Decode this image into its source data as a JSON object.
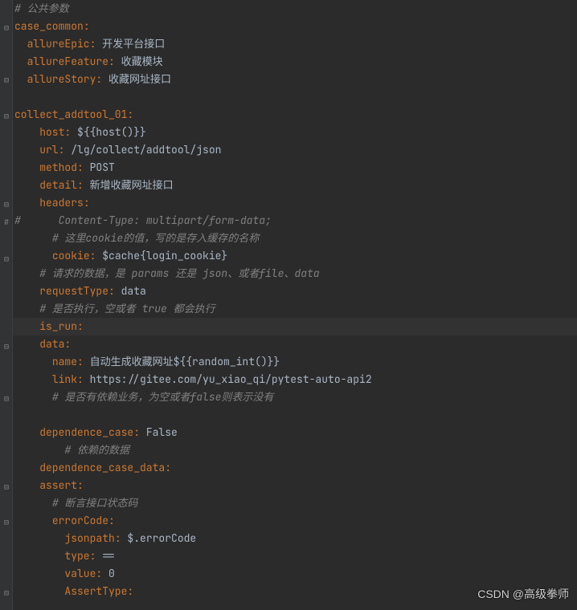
{
  "lines": {
    "l0": {
      "comment": "# 公共参数"
    },
    "l1": {
      "key": "case_common",
      "colon": ":"
    },
    "l2": {
      "key": "allureEpic",
      "colon": ": ",
      "val": "开发平台接口"
    },
    "l3": {
      "key": "allureFeature",
      "colon": ": ",
      "val": "收藏模块"
    },
    "l4": {
      "key": "allureStory",
      "colon": ": ",
      "val": "收藏网址接口"
    },
    "l5": {
      "key": "collect_addtool_01",
      "colon": ":"
    },
    "l6": {
      "key": "host",
      "colon": ": ",
      "val": "${{host()}}"
    },
    "l7": {
      "key": "url",
      "colon": ": ",
      "val": "/lg/collect/addtool/json"
    },
    "l8": {
      "key": "method",
      "colon": ": ",
      "val": "POST"
    },
    "l9": {
      "key": "detail",
      "colon": ": ",
      "val": "新增收藏网址接口"
    },
    "l10": {
      "key": "headers",
      "colon": ":"
    },
    "l11": {
      "comment": "     Content-Type: multipart/form-data;"
    },
    "l12": {
      "comment": "# 这里cookie的值，写的是存入缓存的名称"
    },
    "l13": {
      "key": "cookie",
      "colon": ": ",
      "val": "$cache{login_cookie}"
    },
    "l14": {
      "comment": "# 请求的数据，是 params 还是 json、或者file、data"
    },
    "l15": {
      "key": "requestType",
      "colon": ": ",
      "val": "data"
    },
    "l16": {
      "comment": "# 是否执行，空或者 true 都会执行"
    },
    "l17": {
      "key": "is_run",
      "colon": ":"
    },
    "l18": {
      "key": "data",
      "colon": ":"
    },
    "l19": {
      "key": "name",
      "colon": ": ",
      "val": "自动生成收藏网址${{random_int()}}"
    },
    "l20": {
      "key": "link",
      "colon": ": ",
      "val": "https://gitee.com/yu_xiao_qi/pytest-auto-api2"
    },
    "l21": {
      "comment": "# 是否有依赖业务，为空或者false则表示没有"
    },
    "l22": {
      "key": "dependence_case",
      "colon": ": ",
      "val": "False"
    },
    "l23": {
      "comment": "# 依赖的数据"
    },
    "l24": {
      "key": "dependence_case_data",
      "colon": ":"
    },
    "l25": {
      "key": "assert",
      "colon": ":"
    },
    "l26": {
      "comment": "# 断言接口状态码"
    },
    "l27": {
      "key": "errorCode",
      "colon": ":"
    },
    "l28": {
      "key": "jsonpath",
      "colon": ": ",
      "val": "$.errorCode"
    },
    "l29": {
      "key": "type",
      "colon": ": ",
      "val": "=="
    },
    "l30": {
      "key": "value",
      "colon": ": ",
      "val": "0"
    },
    "l31": {
      "key": "AssertType",
      "colon": ":"
    }
  },
  "watermark": "CSDN @高级拳师",
  "hash": "#"
}
